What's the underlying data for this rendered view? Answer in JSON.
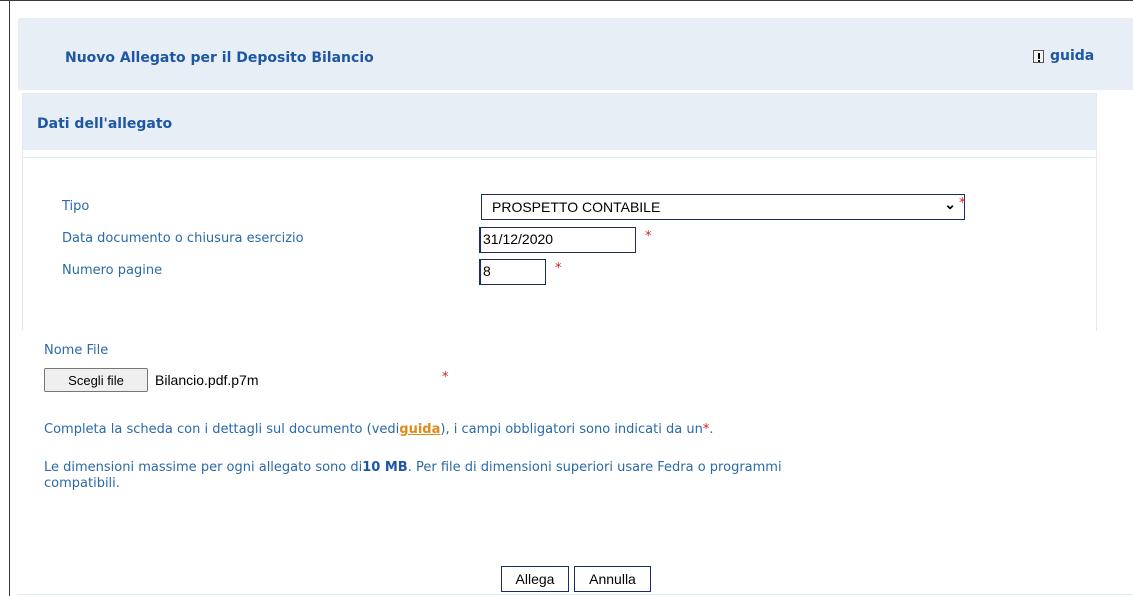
{
  "header": {
    "title": "Nuovo Allegato per il Deposito Bilancio",
    "guida_label": "guida",
    "guida_icon": "exclamation-icon"
  },
  "section": {
    "title": "Dati dell'allegato"
  },
  "form": {
    "tipo_label": "Tipo",
    "tipo_value": "PROSPETTO CONTABILE",
    "data_label": "Data documento o chiusura esercizio",
    "data_value": "31/12/2020",
    "pagine_label": "Numero pagine",
    "pagine_value": "8",
    "required_mark": "*"
  },
  "file": {
    "label": "Nome File",
    "button_label": "Scegli file",
    "file_name": "Bilancio.pdf.p7m"
  },
  "info": {
    "line1_before": "Completa la scheda con i dettagli sul documento (vedi",
    "line1_link": "guida",
    "line1_after": "), i campi obbligatori sono indicati da un",
    "line1_star": "*",
    "line1_end": ".",
    "line2_before": "Le dimensioni massime per ogni allegato sono di",
    "line2_bold": "10 MB",
    "line2_after": ". Per file di dimensioni superiori usare Fedra o programmi",
    "line2_cont": "compatibili."
  },
  "actions": {
    "allega_label": "Allega",
    "annulla_label": "Annulla"
  },
  "colors": {
    "accent_blue": "#1d57a4",
    "text_blue": "#2a6aa8",
    "header_bg": "#e8eef6",
    "required_red": "#cc2222",
    "link_orange": "#e08a1a"
  }
}
